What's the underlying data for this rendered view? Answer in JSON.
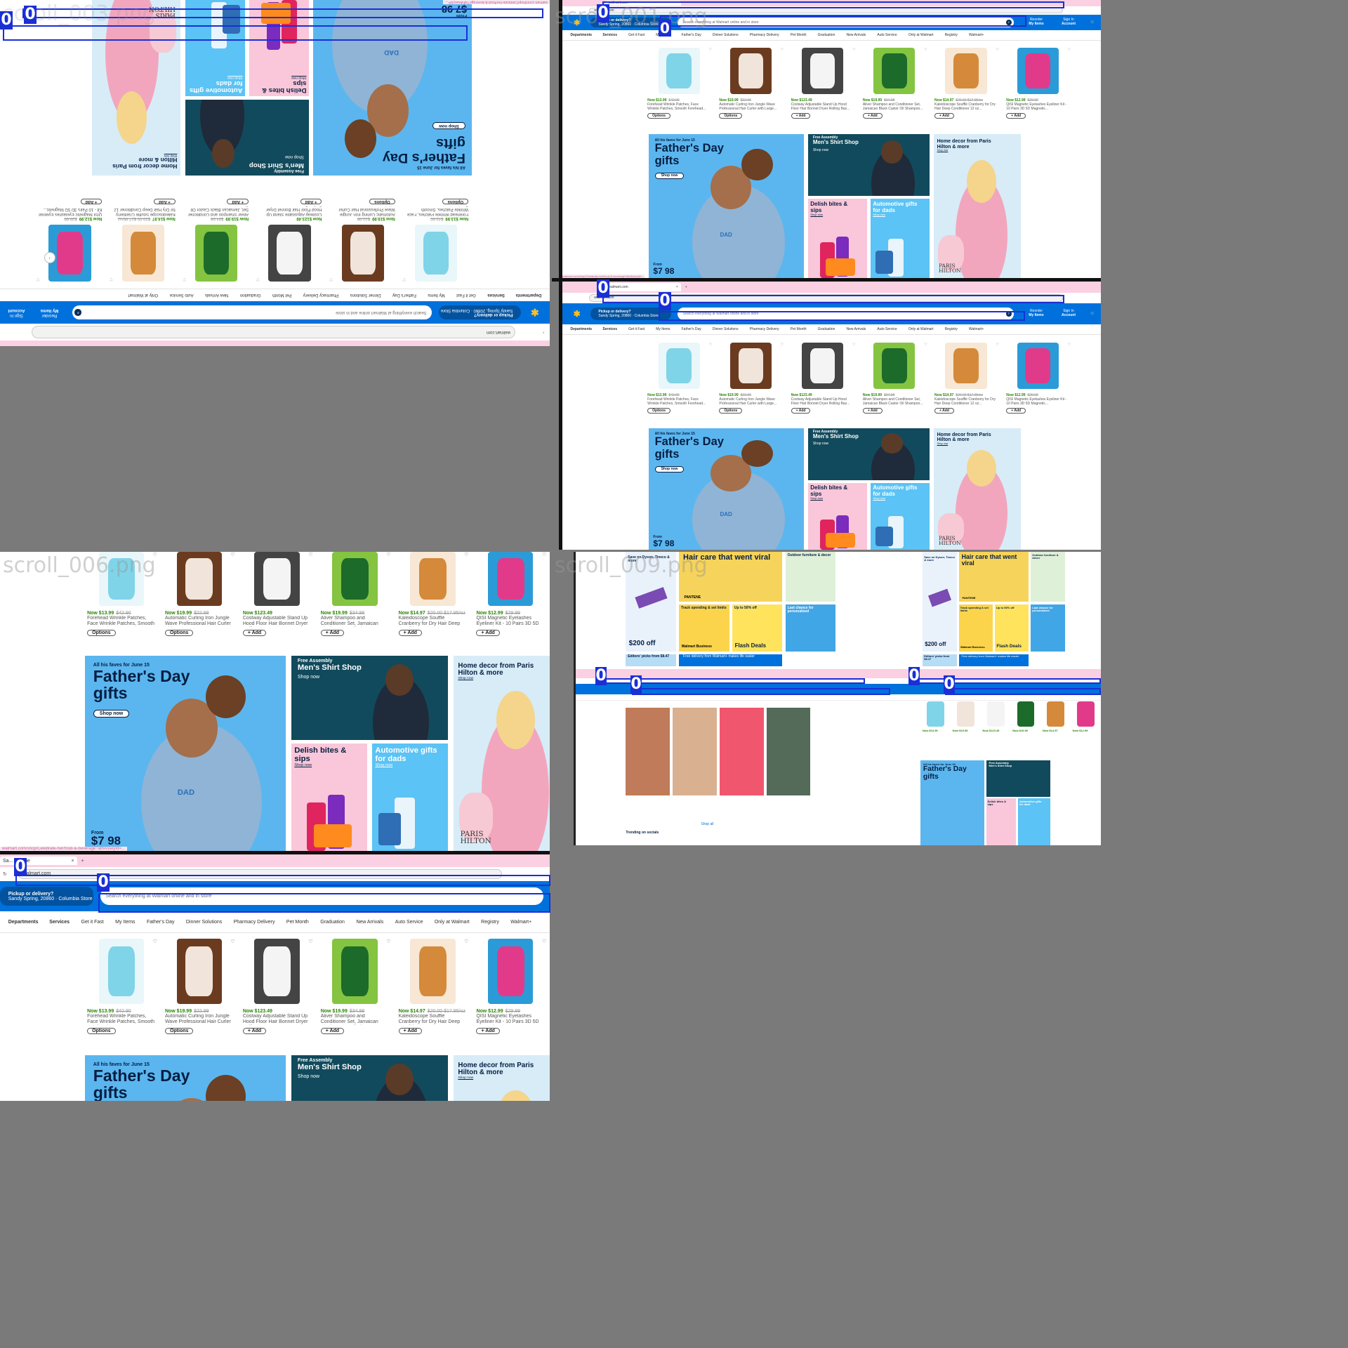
{
  "labels": {
    "scroll_003": "scroll_003.png",
    "scroll_001": "scroll_001.png",
    "scroll_006": "scroll_006.png",
    "scroll_009": "scroll_009.png"
  },
  "overlay_tag": "0",
  "tab": {
    "title": "Sa... Live be",
    "close": "×",
    "new": "+"
  },
  "address": {
    "url": "walmart.com",
    "back": "‹",
    "reload": "↻"
  },
  "header": {
    "logo": "✱",
    "pickup_title": "Pickup or delivery?",
    "pickup_sub": "Sandy Spring, 20860 · Columbia Store",
    "search_placeholder": "Search everything at Walmart online and in store",
    "reorder_label": "Reorder",
    "reorder_sub": "My Items",
    "signin_label": "Sign In",
    "signin_sub": "Account",
    "cart_icon": "🛒",
    "search_glyph": "⌕"
  },
  "nav": {
    "departments": "Departments",
    "services": "Services",
    "links": [
      "Get it Fast",
      "My Items",
      "Father's Day",
      "Dinner Solutions",
      "Pharmacy Delivery",
      "Pet Month",
      "Graduation",
      "New Arrivals",
      "Auto Service",
      "Only at Walmart",
      "Registry",
      "Walmart+"
    ]
  },
  "products": [
    {
      "price": "Now $13.99",
      "was": "$42.90",
      "name": "Forehead Wrinkle Patches, Face Wrinkle Patches, Smooth Forehead...",
      "button": "Options",
      "colors": [
        "#7fd4e8",
        "#e9f6fa"
      ],
      "icon": "face-patches-icon"
    },
    {
      "price": "Now $19.99",
      "was": "$22.99",
      "name": "Automatic Curling Iron Jungle Wave Professional Hair Curler with Large...",
      "button": "Options",
      "colors": [
        "#f1e4da",
        "#6b3b20"
      ],
      "icon": "curling-iron-icon"
    },
    {
      "price": "Now $123.49",
      "was": "",
      "name": "Costway Adjustable Stand Up Hood Floor Hair Bonnet Dryer Rolling Bas...",
      "button": "+ Add",
      "colors": [
        "#f4f4f4",
        "#444444"
      ],
      "icon": "hood-dryer-icon"
    },
    {
      "price": "Now $19.99",
      "was": "$34.98",
      "name": "Aliver Shampoo and Conditioner Set, Jamaican Black Castor Oil Shampoo...",
      "button": "+ Add",
      "colors": [
        "#1c6b2a",
        "#84c441"
      ],
      "icon": "shampoo-bottles-icon"
    },
    {
      "price": "Now $14.97",
      "was": "$20.00 $17.95/oz",
      "name": "Kaleidoscope Soufflé Cranberry for Dry Hair Deep Conditioner 12 oz...",
      "button": "+ Add",
      "colors": [
        "#d48a3a",
        "#f7e7d4"
      ],
      "icon": "conditioner-jar-icon"
    },
    {
      "price": "Now $12.99",
      "was": "$29.99",
      "name": "QISI Magnetic Eyelashes Eyeliner Kit - 10 Pairs 3D 5D Magnetic...",
      "button": "+ Add",
      "colors": [
        "#e23a8a",
        "#2b9bd8"
      ],
      "icon": "eyelash-kit-icon"
    }
  ],
  "banners": {
    "fathers_day": {
      "eyebrow": "All his faves for June 15",
      "title_line1": "Father's Day",
      "title_line2": "gifts",
      "button": "Shop now",
      "from_label": "From",
      "price": "$7 98",
      "shirt_text": "DAD"
    },
    "mens_shirt": {
      "eyebrow": "Free Assembly",
      "title": "Men's Shirt Shop",
      "link": "Shop now"
    },
    "delish": {
      "title_line1": "Delish bites &",
      "title_line2": "sips",
      "link": "Shop now"
    },
    "auto": {
      "title_line1": "Automotive gifts",
      "title_line2": "for dads",
      "link": "Shop now"
    },
    "home_decor": {
      "title_line1": "Home decor from Paris",
      "title_line2": "Hilton & more",
      "link": "Shop now",
      "brand": "PARIS HILTON"
    }
  },
  "status_url": "walmart.com/shop/Celebrate-her/food-&-beverage?athAsseyId=...",
  "scroll009": {
    "tiles": {
      "hair_care": "Hair care that went viral",
      "dyson": "Save on Dyson, Tineco & more",
      "dyson_price": "$200 off",
      "track": "Track spending & set limits",
      "walmart_business": "Walmart Business",
      "upto": "Up to 50% off",
      "flash": "Flash Deals",
      "outdoor": "Outdoor furniture & decor",
      "last_chance": "Last chance for personalized",
      "editors": "Editors' picks from $8.47",
      "free_delivery": "Free delivery from Walmart+ makes life easier",
      "brand": "PANTENE"
    },
    "trending": "Trending on socials",
    "shop_label": "Shop all"
  },
  "colors": {
    "walmart_blue": "#0071dc",
    "walmart_yellow": "#ffc220",
    "price_green": "#2a8703",
    "navy": "#041e42",
    "tab_pink": "#fbd0e2"
  }
}
